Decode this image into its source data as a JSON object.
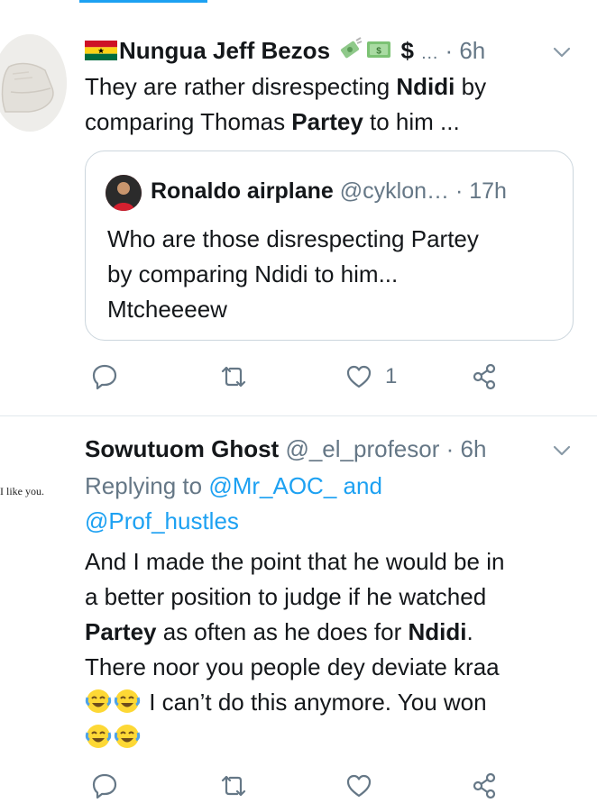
{
  "tweets": [
    {
      "name": "Nungua Jeff Bezos",
      "name_suffix": "$",
      "handle": "…",
      "time": "· 6h",
      "text_lines": [
        [
          "They are rather disrespecting ",
          "Ndidi",
          " by"
        ],
        [
          "comparing Thomas ",
          "Partey",
          " to him ..."
        ]
      ],
      "quote": {
        "name": "Ronaldo airplane",
        "handle": "@cyklon…",
        "time": "· 17h",
        "lines": [
          "Who are those disrespecting Partey",
          "by comparing Ndidi to him...",
          "Mtcheeeew"
        ]
      },
      "actions": {
        "reply_count": "",
        "retweet_count": "",
        "like_count": "1"
      }
    },
    {
      "avatar_text": "I like you.",
      "name": "Sowutuom Ghost",
      "handle": "@_el_profesor",
      "time": "· 6h",
      "replying_prefix": "Replying to",
      "replying_1": "@Mr_AOC_",
      "replying_and": "and",
      "replying_2": "@Prof_hustles",
      "line1": "And I made the point that he would be in",
      "line2": "a better position to judge if he watched",
      "line3_b1": "Partey",
      "line3_mid": " as often as he does for ",
      "line3_b2": "Ndidi",
      "line3_end": ".",
      "line4": "There noor you people dey deviate kraa",
      "line5": " I can’t do this anymore. You won",
      "emoji_name": "face-with-tears-of-joy-icon"
    }
  ],
  "colors": {
    "accent": "#1da1f2",
    "secondary_text": "#657786",
    "border": "#ccd6dd"
  }
}
